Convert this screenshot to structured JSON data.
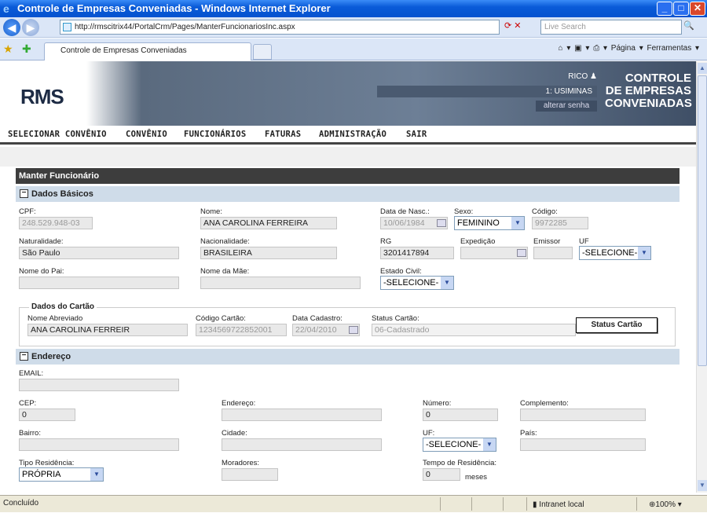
{
  "window": {
    "title": "Controle de Empresas Conveniadas - Windows Internet Explorer",
    "min": "_",
    "max": "□",
    "close": "✕"
  },
  "browser": {
    "url": "http://rmscitrix44/PortalCrm/Pages/ManterFuncionariosInc.aspx",
    "search_placeholder": "Live Search",
    "tab_title": "Controle de Empresas Conveniadas",
    "page_menu": "Página ▾",
    "tools_menu": "Ferramentas ▾"
  },
  "header": {
    "logo": "RMS",
    "user": "RICO",
    "company": "1: USIMINAS",
    "change_password": "alterar senha",
    "brand_line1": "CONTROLE",
    "brand_line2": "DE EMPRESAS",
    "brand_line3": "CONVENIADAS"
  },
  "menu": [
    "SELECIONAR CONVÊNIO",
    "CONVÊNIO",
    "FUNCIONÁRIOS",
    "FATURAS",
    "ADMINISTRAÇÃO",
    "SAIR"
  ],
  "panel_title": "Manter Funcionário",
  "basic": {
    "section": "Dados Básicos",
    "cpf_label": "CPF:",
    "cpf": "248.529.948-03",
    "nome_label": "Nome:",
    "nome": "ANA CAROLINA FERREIRA",
    "nasc_label": "Data de Nasc.:",
    "nasc": "10/06/1984",
    "sexo_label": "Sexo:",
    "sexo": "FEMININO",
    "codigo_label": "Código:",
    "codigo": "9972285",
    "natur_label": "Naturalidade:",
    "natur": "São Paulo",
    "nacio_label": "Nacionalidade:",
    "nacio": "BRASILEIRA",
    "rg_label": "RG",
    "rg": "3201417894",
    "exped_label": "Expedição",
    "emissor_label": "Emissor",
    "uf_label": "UF",
    "uf": "-SELECIONE-",
    "pai_label": "Nome do Pai:",
    "mae_label": "Nome da Mãe:",
    "civil_label": "Estado Civil:",
    "civil": "-SELECIONE-"
  },
  "card": {
    "legend": "Dados do Cartão",
    "abrev_label": "Nome Abreviado",
    "abrev": "ANA CAROLINA FERREIR",
    "cod_label": "Código Cartão:",
    "cod": "1234569722852001",
    "cad_label": "Data Cadastro:",
    "cad": "22/04/2010",
    "status_label": "Status Cartão:",
    "status": "06-Cadastrado",
    "status_button": "Status Cartão"
  },
  "address": {
    "section": "Endereço",
    "email_label": "EMAIL:",
    "cep_label": "CEP:",
    "cep": "0",
    "end_label": "Endereço:",
    "num_label": "Número:",
    "num": "0",
    "compl_label": "Complemento:",
    "bairro_label": "Bairro:",
    "cidade_label": "Cidade:",
    "uf_label": "UF:",
    "uf": "-SELECIONE-",
    "pais_label": "País:",
    "tipo_label": "Tipo Residência:",
    "tipo": "PRÓPRIA",
    "morad_label": "Moradores:",
    "tempo_label": "Tempo de Residência:",
    "tempo": "0",
    "tempo_unit": "meses"
  },
  "statusbar": {
    "text": "Concluído",
    "zone": "Intranet local",
    "zoom": "100%"
  }
}
